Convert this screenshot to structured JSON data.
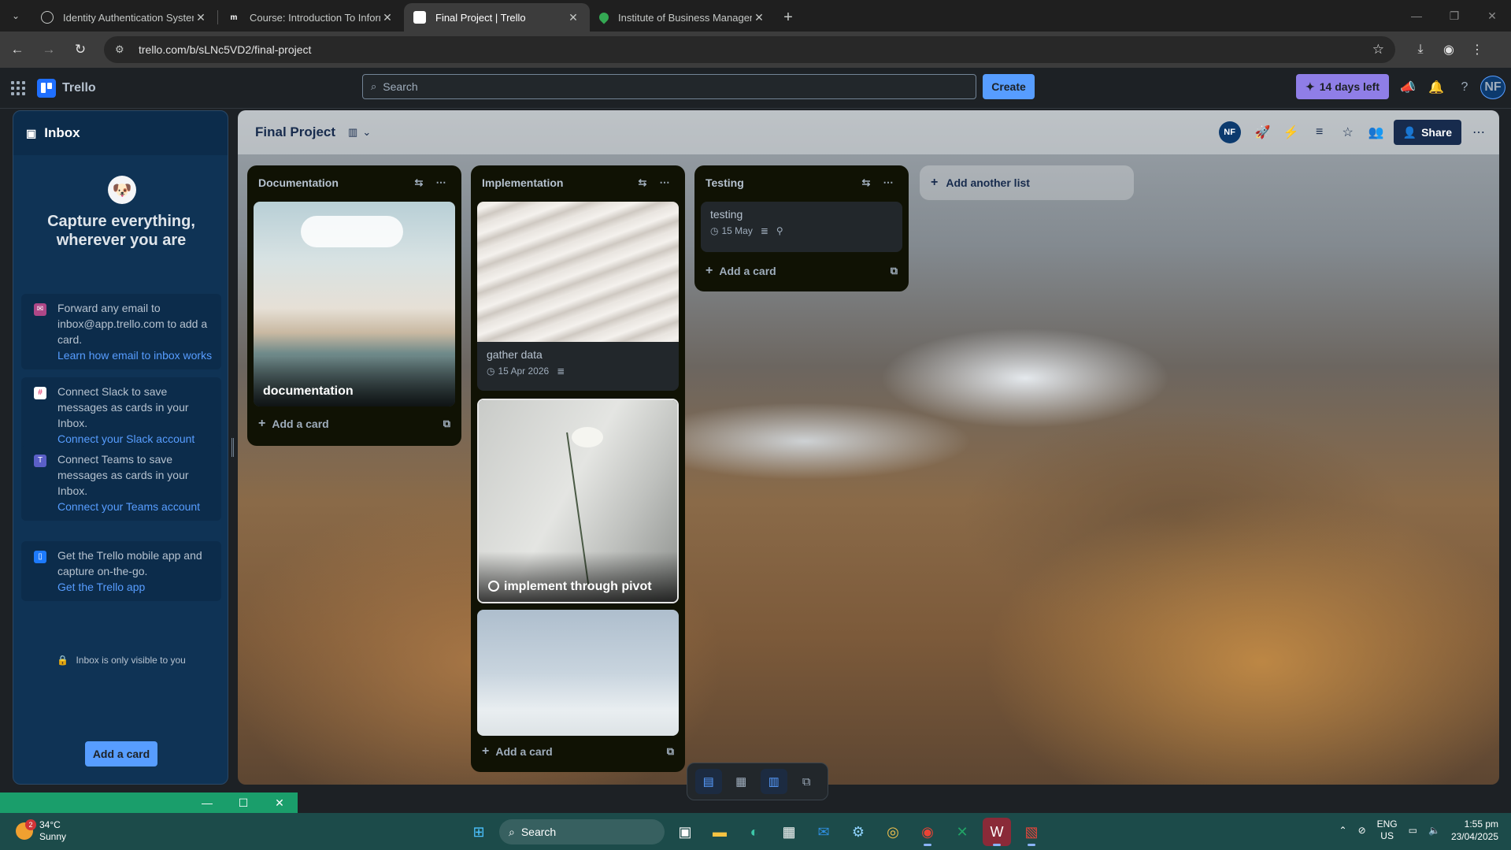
{
  "browser": {
    "tabs": [
      {
        "title": "Identity Authentication System",
        "active": false
      },
      {
        "title": "Course: Introduction To Inform",
        "active": false
      },
      {
        "title": "Final Project | Trello",
        "active": true
      },
      {
        "title": "Institute of Business Manageme",
        "active": false
      }
    ],
    "url": "trello.com/b/sLNc5VD2/final-project"
  },
  "header": {
    "app_name": "Trello",
    "search_placeholder": "Search",
    "create_label": "Create",
    "trial_label": "14 days left",
    "avatar_initials": "NF"
  },
  "inbox": {
    "title": "Inbox",
    "headline": "Capture everything, wherever you are",
    "tips": [
      {
        "text": "Forward any email to inbox@app.trello.com to add a card.",
        "link": "Learn how email to inbox works",
        "icon": "email-icon",
        "color": "#ae4787"
      },
      {
        "text": "Connect Slack to save messages as cards in your Inbox.",
        "link": "Connect your Slack account",
        "icon": "slack-icon",
        "color": "#ffffff"
      },
      {
        "text": "Connect Teams to save messages as cards in your Inbox.",
        "link": "Connect your Teams account",
        "icon": "teams-icon",
        "color": "#5b5fc7"
      },
      {
        "text": "Get the Trello mobile app and capture on-the-go.",
        "link": "Get the Trello app",
        "icon": "mobile-icon",
        "color": "#1d7afc"
      }
    ],
    "privacy_note": "Inbox is only visible to you",
    "add_card_label": "Add a card"
  },
  "board": {
    "name": "Final Project",
    "avatar_initials": "NF",
    "share_label": "Share",
    "add_list_label": "Add another list",
    "lists": [
      {
        "title": "Documentation",
        "cards": [
          {
            "title": "documentation",
            "cover": "lake-landscape"
          }
        ],
        "add_card_label": "Add a card"
      },
      {
        "title": "Implementation",
        "cards": [
          {
            "title": "gather data",
            "cover": "sand-dunes",
            "due": "15 Apr 2026",
            "has_description": true
          },
          {
            "title": "implement through pivot",
            "cover": "white-flower"
          },
          {
            "title": "",
            "cover": "misty-forest"
          }
        ],
        "add_card_label": "Add a card"
      },
      {
        "title": "Testing",
        "cards": [
          {
            "title": "testing",
            "due": "15 May",
            "has_description": true,
            "has_location": true
          }
        ],
        "add_card_label": "Add a card"
      }
    ]
  },
  "taskbar": {
    "weather_temp": "34°C",
    "weather_desc": "Sunny",
    "weather_badge": "2",
    "search_label": "Search",
    "lang_line1": "ENG",
    "lang_line2": "US",
    "time": "1:55 pm",
    "date": "23/04/2025"
  }
}
